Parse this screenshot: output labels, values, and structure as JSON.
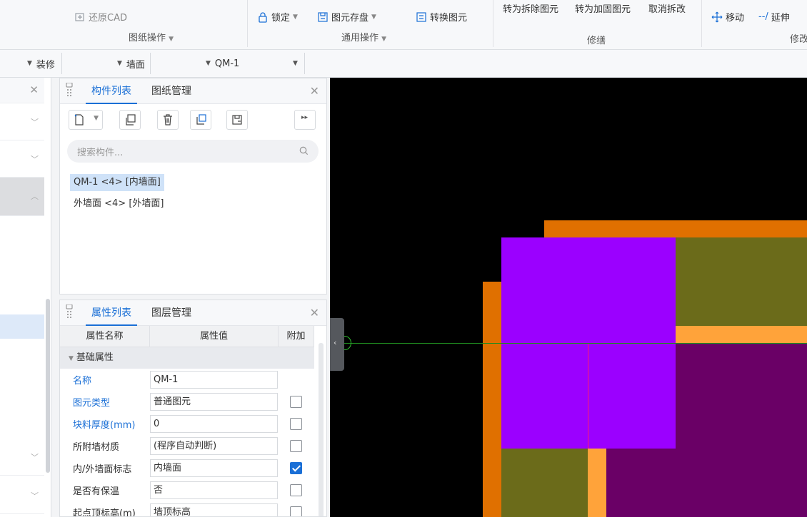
{
  "ribbon": {
    "restore_cad": "还原CAD",
    "drawing_ops_label": "图纸操作",
    "lock": "锁定",
    "save_elements": "图元存盘",
    "convert_elements": "转换图元",
    "general_ops_label": "通用操作",
    "to_demolish": "转为拆除图元",
    "to_reinforce": "转为加固图元",
    "cancel_demolish": "取消拆改",
    "repair_label": "修缮",
    "move": "移动",
    "extend": "延伸",
    "modify_label": "修改"
  },
  "filterbar": {
    "category": "装修",
    "type": "墙面",
    "component": "QM-1"
  },
  "component_panel": {
    "tab_list": "构件列表",
    "tab_drawings": "图纸管理",
    "search_placeholder": "搜索构件...",
    "items": [
      "QM-1 <4> [内墙面]",
      "外墙面 <4> [外墙面]"
    ]
  },
  "property_panel": {
    "tab_props": "属性列表",
    "tab_layers": "图层管理",
    "col_name": "属性名称",
    "col_value": "属性值",
    "col_extra": "附加",
    "group": "基础属性",
    "rows": [
      {
        "name": "名称",
        "value": "QM-1"
      },
      {
        "name": "图元类型",
        "value": "普通图元"
      },
      {
        "name": "块料厚度(mm)",
        "value": "0"
      },
      {
        "name": "所附墙材质",
        "value": "(程序自动判断)"
      },
      {
        "name": "内/外墙面标志",
        "value": "内墙面"
      },
      {
        "name": "是否有保温",
        "value": "否"
      },
      {
        "name": "起点顶标高(m)",
        "value": "墙顶标高"
      }
    ],
    "checked": [
      false,
      false,
      false,
      false,
      true,
      false,
      false
    ]
  },
  "colors": {
    "accent": "#1a6fd6",
    "canvas_bg": "#000000",
    "orange": "#e07000",
    "light_orange": "#ffa33a",
    "violet": "#9b00ff",
    "olive": "#6b6b1a",
    "dark_purple": "#6a0066",
    "axis_line": "#1f8a1f"
  }
}
